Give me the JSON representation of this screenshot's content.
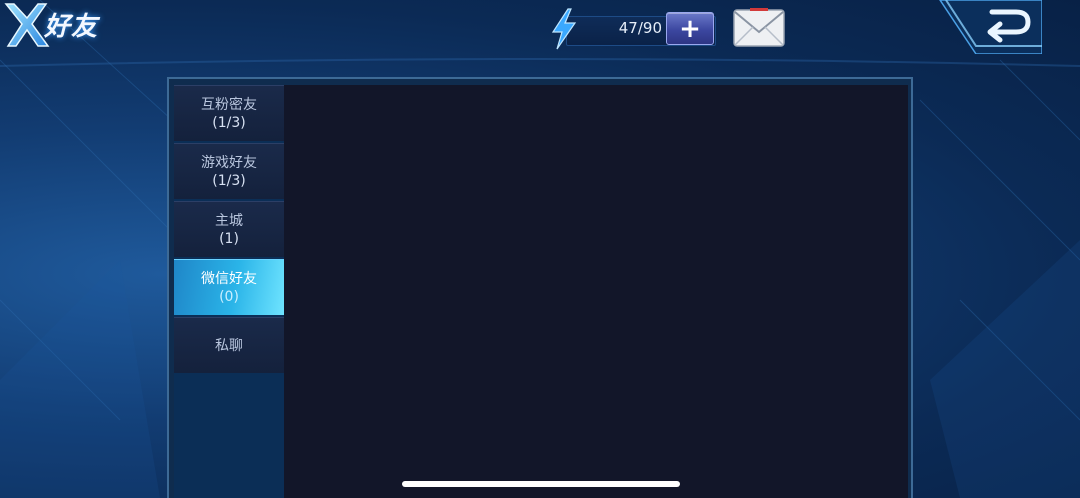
{
  "header": {
    "title": "好友",
    "energy": "47/90",
    "add_energy_label": "+"
  },
  "icons": {
    "logo": "x-logo-icon",
    "energy": "lightning-icon",
    "mail": "mail-icon",
    "back": "back-arrow-icon"
  },
  "sidebar": {
    "tabs": [
      {
        "label": "互粉密友",
        "count": "(1/3)",
        "active": false
      },
      {
        "label": "游戏好友",
        "count": "(1/3)",
        "active": false
      },
      {
        "label": "主城",
        "count": "(1)",
        "active": false
      },
      {
        "label": "微信好友",
        "count": "(0)",
        "active": true
      },
      {
        "label": "私聊",
        "count": "",
        "active": false
      }
    ]
  },
  "colors": {
    "background": "#123c72",
    "active_tab": "#2ab4e8",
    "content_bg": "#121629"
  }
}
